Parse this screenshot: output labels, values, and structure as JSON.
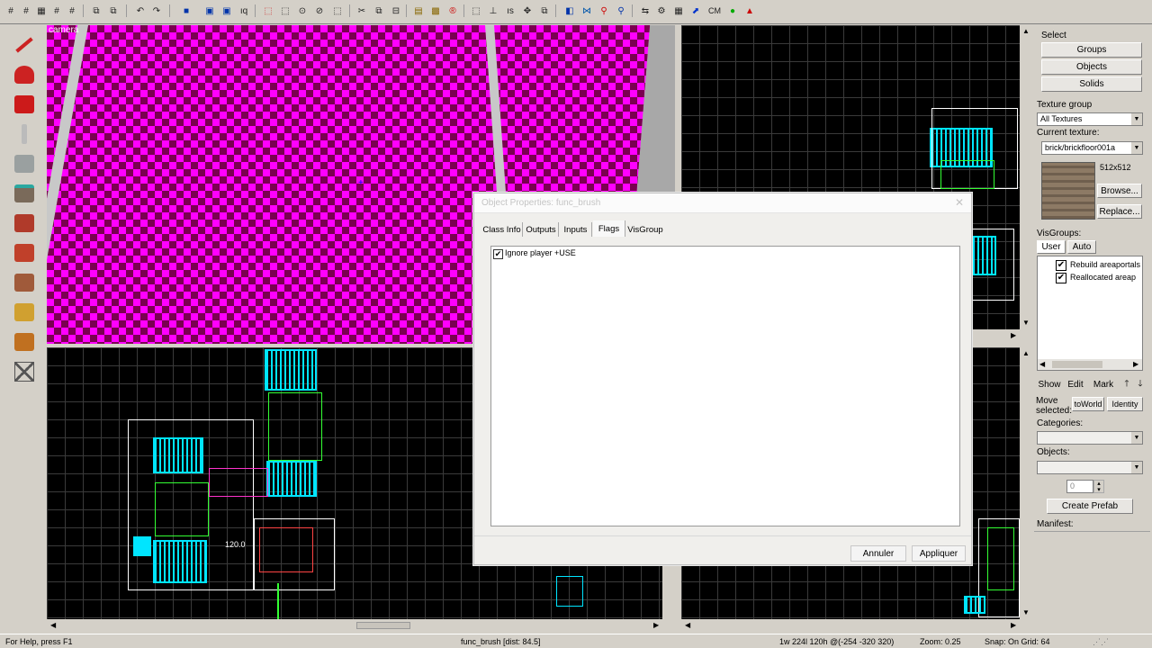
{
  "camera_viewport": {
    "label": "camera"
  },
  "right_panel": {
    "select_label": "Select",
    "groups_button": "Groups",
    "objects_button": "Objects",
    "solids_button": "Solids",
    "texture_group_label": "Texture group",
    "texture_group_value": "All Textures",
    "current_texture_label": "Current texture:",
    "current_texture_value": "brick/brickfloor001a",
    "texture_size": "512x512",
    "browse_button": "Browse...",
    "replace_button": "Replace...",
    "visgroups_label": "VisGroups:",
    "tab_user": "User",
    "tab_auto": "Auto",
    "visgroups": [
      {
        "label": "Rebuild areaportals",
        "checked": true
      },
      {
        "label": "Reallocated areap",
        "checked": true
      }
    ],
    "show_button": "Show",
    "edit_button": "Edit",
    "mark_button": "Mark",
    "move_selected_label": "Move selected:",
    "toworld_button": "toWorld",
    "identity_button": "Identity",
    "categories_label": "Categories:",
    "objects_label": "Objects:",
    "stepper_value": "0",
    "create_prefab_button": "Create Prefab",
    "manifest_label": "Manifest:"
  },
  "dialog": {
    "title": "Object Properties: func_brush",
    "tabs": [
      "Class Info",
      "Outputs",
      "Inputs",
      "Flags",
      "VisGroup"
    ],
    "active_tab": "Flags",
    "flags": [
      {
        "label": "Ignore player +USE",
        "checked": true
      }
    ],
    "cancel_button": "Annuler",
    "apply_button": "Appliquer"
  },
  "viewport_2d": {
    "measure_label": "120.0"
  },
  "statusbar": {
    "help": "For Help, press F1",
    "selection": "func_brush  [dist: 84.5]",
    "coords": "1w 224l 120h @(-254 -320 320)",
    "zoom": "Zoom: 0.25",
    "snap": "Snap: On Grid: 64"
  },
  "toolbar": {
    "cm_label": "CM"
  },
  "colors": {
    "magenta": "#ff00ff",
    "cyan": "#00e5ff",
    "grid": "#3a3a3a",
    "panel": "#d4d0c8"
  }
}
